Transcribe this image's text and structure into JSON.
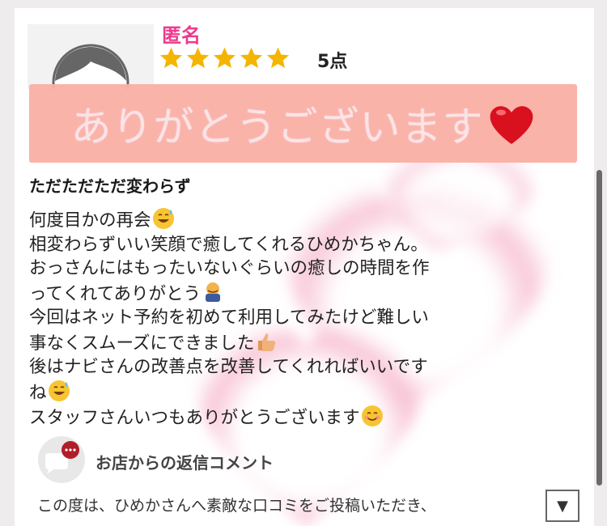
{
  "review": {
    "reviewer_name": "匿名",
    "rating_score": "5点",
    "stars_count": 5,
    "banner_text": "ありがとうございます",
    "banner_icon": "red-heart-icon",
    "title": "ただただただ変わらず",
    "body_lines": [
      {
        "text": "何度目かの再会",
        "emoji": "sweat-smile-icon"
      },
      {
        "text": "相変わらずいい笑顔で癒してくれるひめかちゃん。",
        "emoji": ""
      },
      {
        "text": "おっさんにはもったいないぐらいの癒しの時間を作",
        "emoji": ""
      },
      {
        "text": "ってくれてありがとう",
        "emoji": "bowing-person-icon"
      },
      {
        "text": "今回はネット予約を初めて利用してみたけど難しい",
        "emoji": ""
      },
      {
        "text": "事なくスムーズにできました",
        "emoji": "thumbs-up-icon"
      },
      {
        "text": "後はナビさんの改善点を改善してくれればいいです",
        "emoji": ""
      },
      {
        "text": "ね",
        "emoji": "sweat-smile-icon"
      },
      {
        "text": "スタッフさんいつもありがとうございます",
        "emoji": "smile-icon"
      }
    ]
  },
  "reply": {
    "heading": "お店からの返信コメント",
    "preview": "この度は、ひめかさんへ素敵な口コミをご投稿いただき、",
    "expand_label": "▼"
  },
  "colors": {
    "name": "#ee3a8c",
    "star": "#f5b400",
    "banner": "#fab0a6",
    "heart": "#d9101e"
  }
}
